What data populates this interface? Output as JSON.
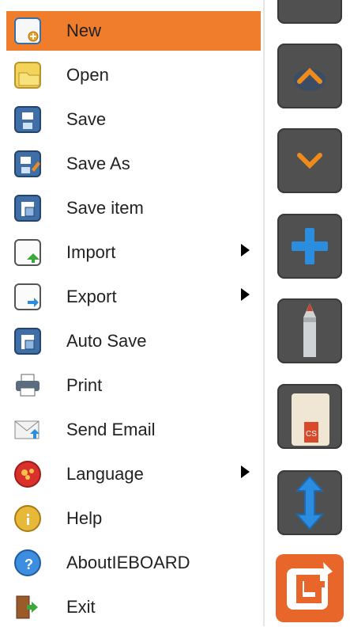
{
  "menu": {
    "items": [
      {
        "label": "New",
        "icon": "new-file-icon",
        "active": true
      },
      {
        "label": "Open",
        "icon": "open-folder-icon"
      },
      {
        "label": "Save",
        "icon": "save-icon"
      },
      {
        "label": "Save As",
        "icon": "save-as-icon"
      },
      {
        "label": "Save item",
        "icon": "save-item-icon"
      },
      {
        "label": "Import",
        "icon": "import-icon",
        "submenu": true
      },
      {
        "label": "Export",
        "icon": "export-icon",
        "submenu": true
      },
      {
        "label": "Auto Save",
        "icon": "auto-save-icon"
      },
      {
        "label": "Print",
        "icon": "print-icon"
      },
      {
        "label": "Send Email",
        "icon": "email-icon"
      },
      {
        "label": "Language",
        "icon": "language-icon",
        "submenu": true
      },
      {
        "label": "Help",
        "icon": "help-icon"
      },
      {
        "label": "AboutIEBOARD",
        "icon": "about-icon"
      },
      {
        "label": "Exit",
        "icon": "exit-icon"
      }
    ]
  },
  "toolbar": {
    "buttons": [
      {
        "icon": "chevron-up-icon"
      },
      {
        "icon": "chevron-down-icon"
      },
      {
        "icon": "plus-icon"
      },
      {
        "icon": "pen-icon"
      },
      {
        "icon": "eraser-icon"
      },
      {
        "icon": "vertical-arrows-icon"
      },
      {
        "icon": "ieboard-logo-icon"
      }
    ]
  },
  "colors": {
    "menu_active": "#f07d2c",
    "tool_button": "#505050",
    "logo_button": "#e9662a",
    "accent_blue": "#2a8de0",
    "accent_orange": "#f08a1c"
  }
}
